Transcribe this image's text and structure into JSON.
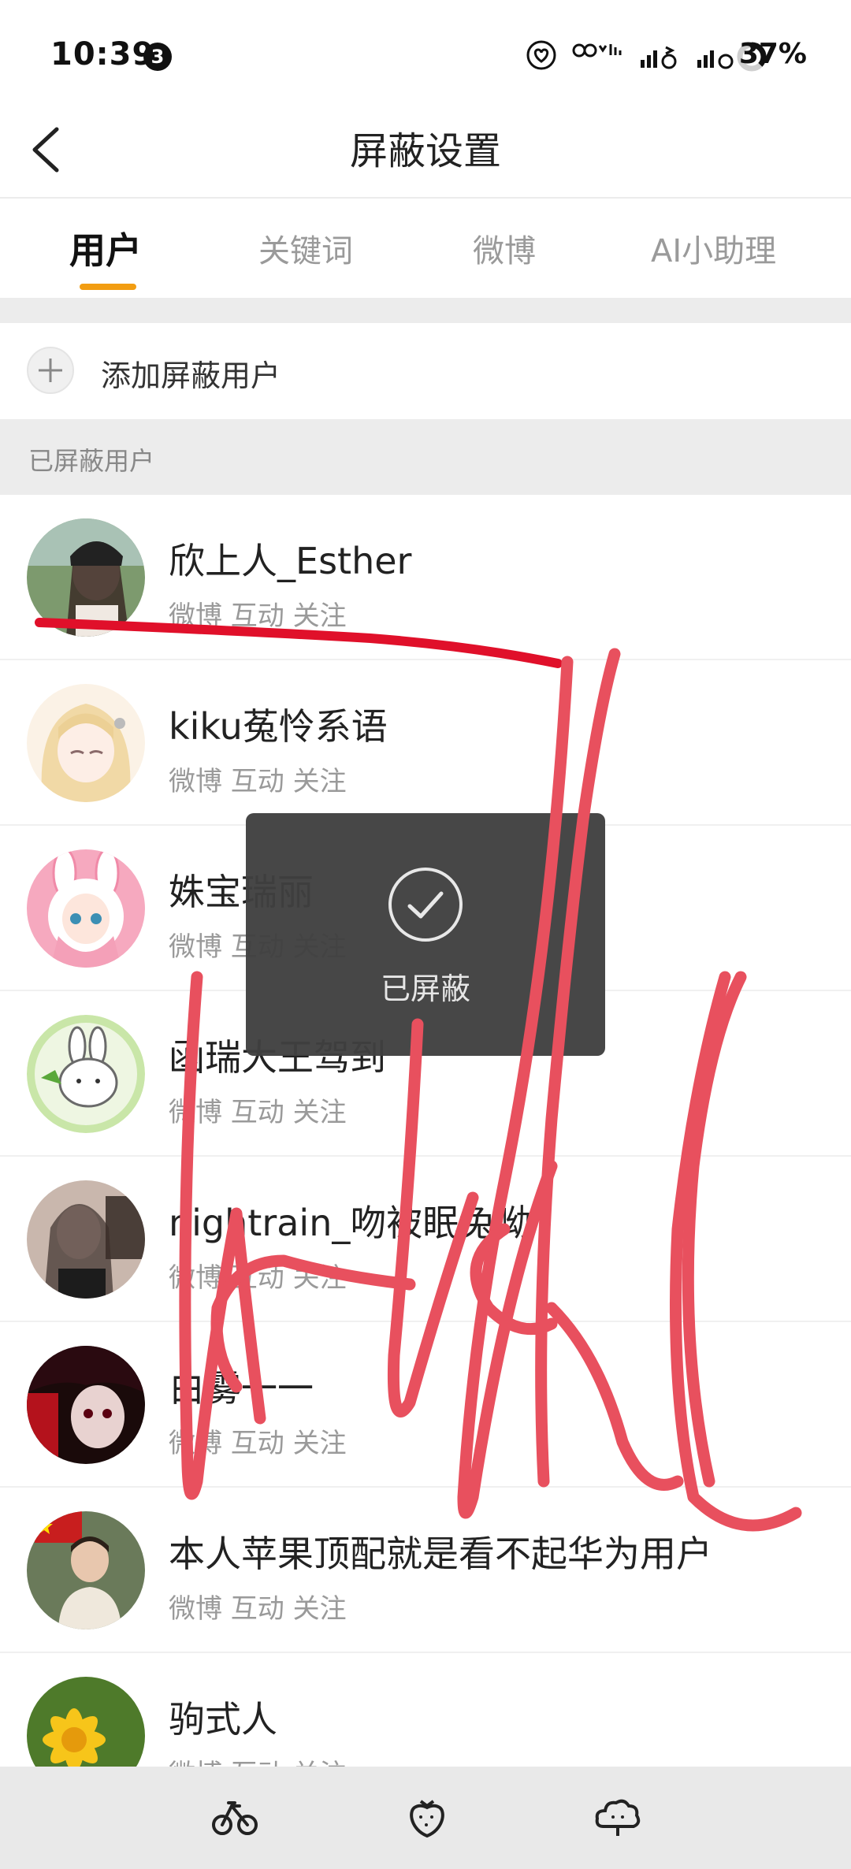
{
  "status_bar": {
    "time": "10:39",
    "notification_count": "3",
    "battery_percent": "37%",
    "battery_level": 0.37
  },
  "header": {
    "title": "屏蔽设置",
    "back_icon": "chevron-left-icon"
  },
  "tabs": [
    {
      "label": "用户",
      "active": true
    },
    {
      "label": "关键词",
      "active": false
    },
    {
      "label": "微博",
      "active": false
    },
    {
      "label": "AI小助理",
      "active": false
    }
  ],
  "add_block_user": {
    "label": "添加屏蔽用户",
    "icon": "plus-icon"
  },
  "section_title": "已屏蔽用户",
  "blocked_users": [
    {
      "name": "欣上人_Esther",
      "meta": "微博 互动 关注"
    },
    {
      "name": "kiku菟怜系语",
      "meta": "微博 互动 关注"
    },
    {
      "name": "姝宝瑞丽",
      "meta": "微博 互动 关注"
    },
    {
      "name": "函瑞大王驾到",
      "meta": "微博 互动 关注"
    },
    {
      "name": "nightrain_吻被眠兔呦",
      "meta": "微博 互动 关注"
    },
    {
      "name": "白雾一一",
      "meta": "微博 互动 关注"
    },
    {
      "name": "本人苹果顶配就是看不起华为用户",
      "meta": "微博 互动 关注"
    },
    {
      "name": "驹式人",
      "meta": "微博 互动 关注"
    }
  ],
  "toast": {
    "text": "已屏蔽",
    "icon": "check-circle-icon"
  },
  "bottom_bar": {
    "icons": [
      "bicycle-icon",
      "strawberry-icon",
      "flower-cloud-icon"
    ]
  },
  "colors": {
    "accent": "#f29d12",
    "scribble": "#e8505e",
    "underline_mark": "#e0102a",
    "toast_bg": "#404040"
  }
}
